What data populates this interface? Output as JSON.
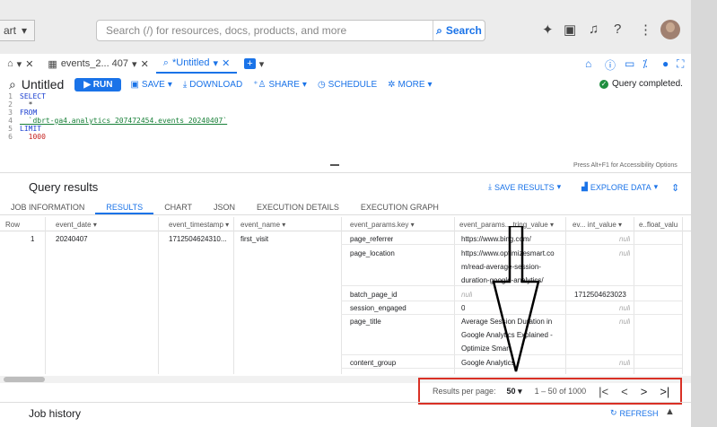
{
  "topbar": {
    "project_label": "art",
    "search_placeholder": "Search (/) for resources, docs, products, and more",
    "search_button": "Search"
  },
  "tabs": [
    {
      "label": "events_2... 407"
    },
    {
      "label": "*Untitled"
    }
  ],
  "toolbar": {
    "title": "Untitled",
    "run": "RUN",
    "save": "SAVE",
    "download": "DOWNLOAD",
    "share": "SHARE",
    "schedule": "SCHEDULE",
    "more": "MORE",
    "status": "Query completed."
  },
  "editor": {
    "lines": [
      {
        "n": "1",
        "code": "SELECT"
      },
      {
        "n": "2",
        "code": "  *"
      },
      {
        "n": "3",
        "code": "FROM"
      },
      {
        "n": "4",
        "code": "  `dbrt-ga4.analytics_207472454.events_20240407`"
      },
      {
        "n": "5",
        "code": "LIMIT"
      },
      {
        "n": "6",
        "code": "  1000"
      }
    ],
    "hint": "Press Alt+F1 for Accessibility Options"
  },
  "results": {
    "title": "Query results",
    "save_results": "SAVE RESULTS",
    "explore_data": "EXPLORE DATA",
    "tabs": [
      "JOB INFORMATION",
      "RESULTS",
      "CHART",
      "JSON",
      "EXECUTION DETAILS",
      "EXECUTION GRAPH"
    ],
    "columns": [
      "Row",
      "event_date",
      "event_timestamp",
      "event_name",
      "event_params.key",
      "event_params....tring_value",
      "ev... int_value",
      "e..float_valu"
    ],
    "row": {
      "row": "1",
      "event_date": "20240407",
      "event_timestamp": "1712504624310...",
      "event_name": "first_visit"
    },
    "params": [
      {
        "key": "page_referrer",
        "string_value": [
          "https://www.bing.com/"
        ],
        "int_value": "null",
        "int_is_null": true
      },
      {
        "key": "page_location",
        "string_value": [
          "https://www.optimizesmart.co",
          "m/read-average-session-",
          "duration-google-analytics/"
        ],
        "int_value": "null",
        "int_is_null": true
      },
      {
        "key": "batch_page_id",
        "string_value": [
          "null"
        ],
        "string_is_null": true,
        "int_value": "1712504623023"
      },
      {
        "key": "session_engaged",
        "string_value": [
          "0"
        ],
        "int_value": "null",
        "int_is_null": true
      },
      {
        "key": "page_title",
        "string_value": [
          "Average Session Duration in",
          "Google Analytics Explained -",
          "Optimize Smart"
        ],
        "int_value": "null",
        "int_is_null": true
      },
      {
        "key": "content_group",
        "string_value": [
          "Google Analytics"
        ],
        "int_value": "null",
        "int_is_null": true
      }
    ]
  },
  "pager": {
    "label": "Results per page:",
    "per_page": "50",
    "range": "1 – 50 of 1000"
  },
  "job_history": {
    "title": "Job history",
    "refresh": "REFRESH"
  },
  "colors": {
    "accent": "#1a73e8",
    "highlight": "#d93025",
    "success": "#1e8e3e"
  }
}
